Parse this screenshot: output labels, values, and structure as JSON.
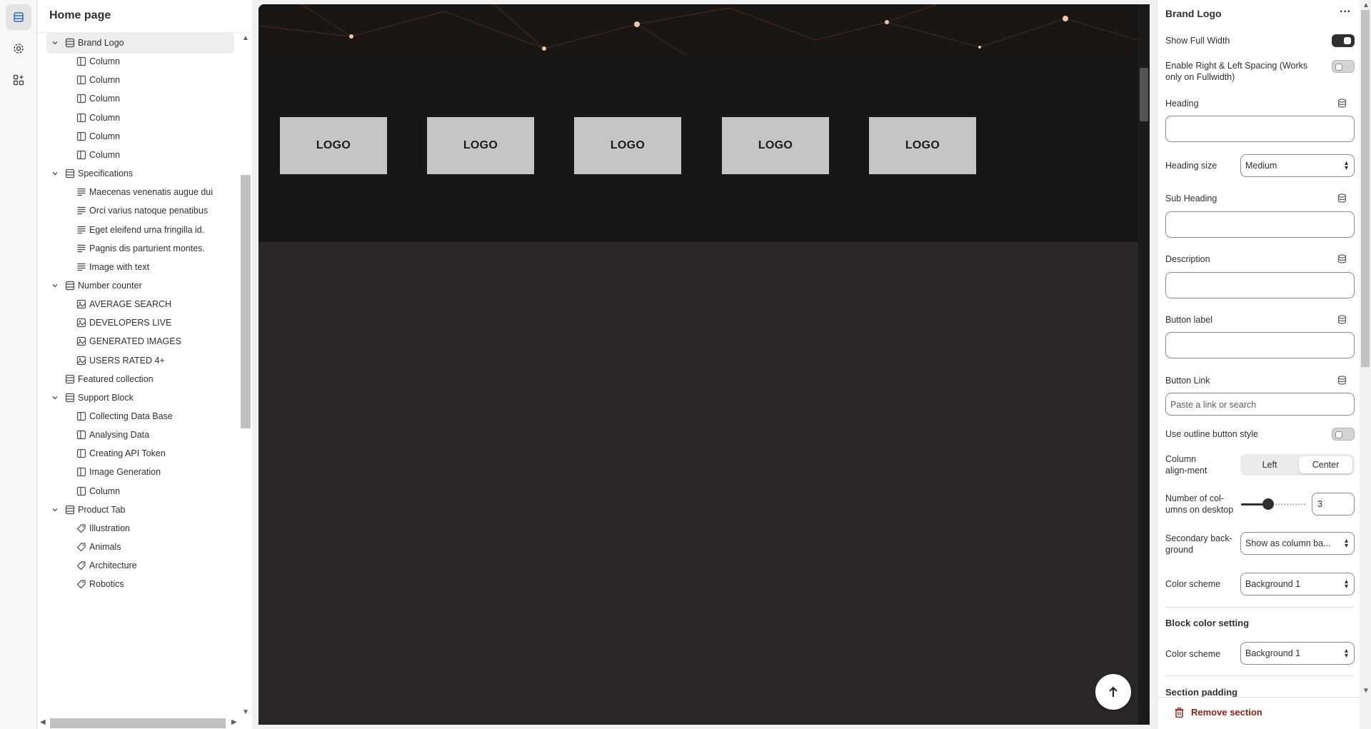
{
  "rail": {
    "items": [
      {
        "icon": "sections-icon",
        "active": true
      },
      {
        "icon": "gear-icon",
        "active": false
      },
      {
        "icon": "apps-icon",
        "active": false
      }
    ]
  },
  "sidebar": {
    "title": "Home page",
    "tree": [
      {
        "label": "Brand Logo",
        "level": 1,
        "icon": "section-icon",
        "expanded": true,
        "selected": true
      },
      {
        "label": "Column",
        "level": 2,
        "icon": "column-icon"
      },
      {
        "label": "Column",
        "level": 2,
        "icon": "column-icon"
      },
      {
        "label": "Column",
        "level": 2,
        "icon": "column-icon"
      },
      {
        "label": "Column",
        "level": 2,
        "icon": "column-icon"
      },
      {
        "label": "Column",
        "level": 2,
        "icon": "column-icon"
      },
      {
        "label": "Column",
        "level": 2,
        "icon": "column-icon"
      },
      {
        "label": "Specifications",
        "level": 1,
        "icon": "section-icon",
        "expanded": true
      },
      {
        "label": "Maecenas venenatis augue dui",
        "level": 2,
        "icon": "text-icon"
      },
      {
        "label": "Orci varius natoque penatibus",
        "level": 2,
        "icon": "text-icon"
      },
      {
        "label": "Eget eleifend urna fringilla id.",
        "level": 2,
        "icon": "text-icon"
      },
      {
        "label": "Pagnis dis parturient montes.",
        "level": 2,
        "icon": "text-icon"
      },
      {
        "label": "Image with text",
        "level": 2,
        "icon": "text-icon"
      },
      {
        "label": "Number counter",
        "level": 1,
        "icon": "section-icon",
        "expanded": true
      },
      {
        "label": "AVERAGE SEARCH",
        "level": 2,
        "icon": "image-icon"
      },
      {
        "label": "DEVELOPERS LIVE",
        "level": 2,
        "icon": "image-icon"
      },
      {
        "label": "GENERATED IMAGES",
        "level": 2,
        "icon": "image-icon"
      },
      {
        "label": "USERS RATED 4+",
        "level": 2,
        "icon": "image-icon"
      },
      {
        "label": "Featured collection",
        "level": 1,
        "icon": "section-icon",
        "expanded": false,
        "nochev": true
      },
      {
        "label": "Support Block",
        "level": 1,
        "icon": "section-icon",
        "expanded": true
      },
      {
        "label": "Collecting Data Base",
        "level": 2,
        "icon": "column-icon"
      },
      {
        "label": "Analysing Data",
        "level": 2,
        "icon": "column-icon"
      },
      {
        "label": "Creating API Token",
        "level": 2,
        "icon": "column-icon"
      },
      {
        "label": "Image Generation",
        "level": 2,
        "icon": "column-icon"
      },
      {
        "label": "Column",
        "level": 2,
        "icon": "column-icon"
      },
      {
        "label": "Product Tab",
        "level": 1,
        "icon": "section-icon",
        "expanded": true
      },
      {
        "label": "Illustration",
        "level": 2,
        "icon": "tag-icon"
      },
      {
        "label": "Animals",
        "level": 2,
        "icon": "tag-icon"
      },
      {
        "label": "Architecture",
        "level": 2,
        "icon": "tag-icon"
      },
      {
        "label": "Robotics",
        "level": 2,
        "icon": "tag-icon"
      }
    ]
  },
  "preview": {
    "logos": [
      "LOGO",
      "LOGO",
      "LOGO",
      "LOGO",
      "LOGO"
    ]
  },
  "panel": {
    "title": "Brand Logo",
    "show_full_width": {
      "label": "Show Full Width",
      "on": true
    },
    "spacing": {
      "label": "Enable Right & Left Spacing (Works only on Fullwidth)",
      "on": false
    },
    "heading": {
      "label": "Heading",
      "value": ""
    },
    "heading_size": {
      "label": "Heading size",
      "value": "Medium"
    },
    "sub_heading": {
      "label": "Sub Heading",
      "value": ""
    },
    "description": {
      "label": "Description",
      "value": ""
    },
    "button_label": {
      "label": "Button label",
      "value": ""
    },
    "button_link": {
      "label": "Button Link",
      "placeholder": "Paste a link or search"
    },
    "outline": {
      "label": "Use outline button style",
      "on": false
    },
    "column_alignment": {
      "label": "Column align-ment",
      "options": [
        "Left",
        "Center"
      ],
      "selected": "Center"
    },
    "columns_desktop": {
      "label": "Number of col-umns on desktop",
      "value": "3"
    },
    "secondary_bg": {
      "label": "Secondary back-ground",
      "value": "Show as column ba..."
    },
    "color_scheme": {
      "label": "Color scheme",
      "value": "Background 1"
    },
    "block_color_heading": "Block color setting",
    "block_color_scheme": {
      "label": "Color scheme",
      "value": "Background 1"
    },
    "section_padding": "Section padding",
    "remove_label": "Remove section"
  }
}
